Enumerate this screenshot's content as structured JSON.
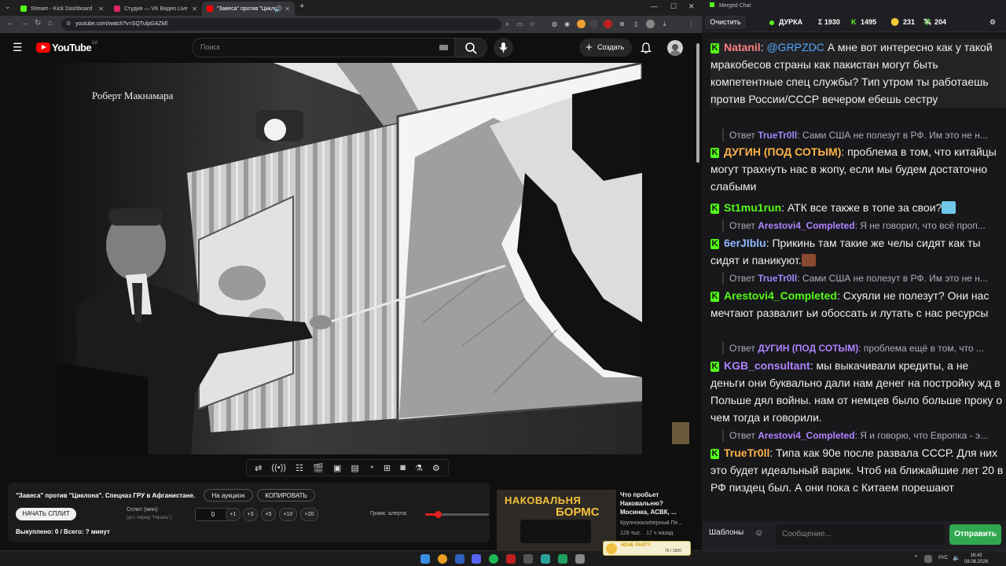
{
  "colors": {
    "kick_green": "#53fc18",
    "youtube_red": "#ff0000",
    "send_button": "#2fa84f",
    "chat_bg": "#18181b"
  },
  "tabs": [
    {
      "label": "Stream - Kick Dashboard",
      "favicon": "kick-icon",
      "color": "#53fc18"
    },
    {
      "label": "Студия — VK Видео Live",
      "favicon": "vk-video-icon",
      "color": "#e0245e"
    },
    {
      "label": "\"Завеса\" против \"Циклона\"",
      "favicon": "youtube-icon",
      "color": "#ff0000"
    }
  ],
  "url": "youtube.com/watch?v=SQTulpGAZkE",
  "youtube": {
    "logo_text": "YouTube",
    "country_code": "LV",
    "search_placeholder": "Поиск",
    "create_label": "Создать",
    "video_caption": "Роберт Макнамара"
  },
  "split_panel": {
    "title": "\"Завеса\" против \"Циклона\". Спецназ ГРУ в Афганистане.",
    "auction_label": "На аукцион",
    "copy_label": "КОПИРОВАТЬ",
    "start_label": "НАЧАТЬ СПЛИТ",
    "split_label": "Сплит (мин):",
    "split_hint": "(уст. перед \"Начать\")",
    "split_value": "0",
    "increments": [
      "+1",
      "+3",
      "+5",
      "+10",
      "+20"
    ],
    "volume_label": "Громк. алерта:",
    "volume_level": 0.2,
    "bought_text": "Выкуплено: 0 / Всего: ? минут"
  },
  "recommendation": {
    "thumb_text_1": "НАКОВАЛЬНЯ",
    "thumb_text_2": "БОРМС",
    "title": "Что пробьет Наковальню? Мосинка, АСВК, ...",
    "channel": "Крупнокалиберный Пе...",
    "views": "129 тыс.",
    "age": "17 ч назад"
  },
  "taskbar": {
    "lang": "РУС",
    "time": "16:43",
    "date": "08.08.2026",
    "party_label": "НЕНЕ PARTY",
    "party_count": "75 / 1500"
  },
  "chat": {
    "window_title": "Merged Chat",
    "clear_label": "Очистить",
    "status_name": "ДУРКА",
    "stats": [
      {
        "icon": "sigma",
        "value": "Σ 1930"
      },
      {
        "icon": "kick-icon",
        "value": "1495"
      },
      {
        "icon": "coins-icon",
        "value": "231"
      },
      {
        "icon": "dollar-icon",
        "value": "204"
      }
    ],
    "templates_label": "Шаблоны",
    "input_placeholder": "Сообщение...",
    "send_label": "Отправить",
    "reply_prefix": "Ответ",
    "messages": [
      {
        "user": "Natanil",
        "color": "#ff7f7f",
        "mention": "@GRPZDC",
        "text": "А мне вот интересно как у такой мракобесов страны как пакистан могут быть компетентные спец службы? Тип утром ты работаешь против России/СССР вечером ебешь сестру"
      },
      {
        "reply_user": "TrueTr0ll",
        "reply_color": "#9b8cff",
        "reply_text": "Сами США не полезут в РФ. Им это не н..."
      },
      {
        "user": "ДУГИН (ПОД СОТЫМ)",
        "color": "#ffb347",
        "text": "проблема в том, что китайцы могут трахнуть нас в жопу, если мы будем достаточно слабыми"
      },
      {
        "user": "St1mu1run",
        "color": "#53fc18",
        "text": "АТК все также в топе за свои?"
      },
      {
        "reply_user": "Arestovi4_Completed",
        "reply_color": "#b083ff",
        "reply_text": "Я не говорил, что всё проп..."
      },
      {
        "user": "6erJIblu",
        "color": "#8fb6ff",
        "text": "Прикинь там такие же челы сидят как ты сидят и паникуют."
      },
      {
        "reply_user": "TrueTr0ll",
        "reply_color": "#9b8cff",
        "reply_text": "Сами США не полезут в РФ. Им это не н..."
      },
      {
        "user": "Arestovi4_Completed",
        "color": "#53fc18",
        "text": "Схуяли не полезут? Они нас мечтают развалит ьи обоссать и лутать с нас ресурсы"
      },
      {
        "reply_user": "ДУГИН (ПОД СОТЫМ)",
        "reply_color": "#b083ff",
        "reply_text": "проблема ещё в том, что ..."
      },
      {
        "user": "KGB_consultant",
        "color": "#b083ff",
        "text": "мы выкачивали кредиты, а не деньги они буквально дали нам денег на постройку жд в Польше дял войны. нам от немцев было больше проку о чем тогда и говорили."
      },
      {
        "reply_user": "Arestovi4_Completed",
        "reply_color": "#b083ff",
        "reply_text": "Я и говорю, что Европка - э..."
      },
      {
        "user": "TrueTr0ll",
        "color": "#ffb347",
        "text": "Типа как 90е после развала СССР. Для них это будет идеальный варик. Чтоб на ближайшие лет 20 в РФ пиздец был. А они пока с Китаем порешают"
      }
    ]
  }
}
